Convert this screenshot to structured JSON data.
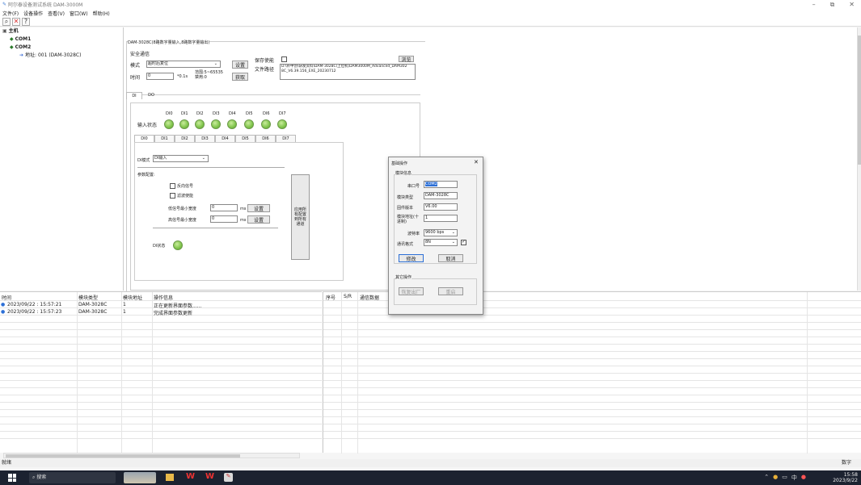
{
  "window": {
    "title": "阿尔泰设备测试系统 DAM-3000M",
    "minimize": "–",
    "maximize": "⧉",
    "close": "✕"
  },
  "menu": [
    "文件(F)",
    "设备操作",
    "查看(V)",
    "窗口(W)",
    "帮助(H)"
  ],
  "toolbar": {
    "search_icon": "⌕",
    "delete_icon": "✕",
    "help_icon": "?"
  },
  "tree": {
    "root": "主机",
    "com1": "COM1",
    "com2": "COM2",
    "device": "地址: 001 (DAM-3028C)"
  },
  "module": {
    "group_title": "DAM-3028C(8路数字量输入,8路数字量输出)",
    "safety_title": "安全通信",
    "mode_label": "模式",
    "mode_value": "超时后复位",
    "set_btn": "设置",
    "time_label": "时间",
    "time_value": "0",
    "time_unit": "*0.1s",
    "range_label": "范围:5~65535",
    "disable_label": "禁用:0",
    "get_btn": "获取",
    "save_enable_label": "保存使能",
    "save_path_label": "文件路径",
    "browse_btn": "浏览",
    "save_path_value": "D:\\补中创\\研发资料\\DAM-3028C\\上位机\\DAM3000M_Advanced_DAM3028C_V6.39.156_EXE_20230712"
  },
  "tabs_top": [
    "DI",
    "DO"
  ],
  "di_channels": [
    "DI0",
    "DI1",
    "DI2",
    "DI3",
    "DI4",
    "DI5",
    "DI6",
    "DI7"
  ],
  "input_status_label": "输入状态",
  "di_config": {
    "mode_label": "DI模式",
    "mode_value": "DI输入",
    "param_label": "参数配置:",
    "reverse": "反向信号",
    "filter": "滤波使能",
    "low_label": "低信号最小宽度",
    "low_value": "0",
    "low_unit": "ms",
    "high_label": "高信号最小宽度",
    "high_value": "0",
    "high_unit": "ms",
    "set1": "设置",
    "set2": "设置",
    "apply_all": "应用所有配置到所有通道",
    "state_label": "DI状态"
  },
  "dialog": {
    "title": "基础操作",
    "close": "✕",
    "module_info": "模块信息",
    "port_label": "串口号",
    "port_value": "COM2",
    "type_label": "模块类型",
    "type_value": "DAM-3028C",
    "firmware_label": "固件版本",
    "firmware_value": "V6.00",
    "addr_label": "模块地址(十进制)",
    "addr_value": "1",
    "baud_label": "波特率",
    "baud_value": "9600 bps",
    "fmt_label": "通讯格式",
    "fmt_value": "8N",
    "modify": "修改",
    "cancel": "取消",
    "other": "其它操作",
    "factory": "恢复出厂",
    "reboot": "重启"
  },
  "log": {
    "headers": [
      "时间",
      "模块类型",
      "模块地址",
      "操作信息"
    ],
    "rows": [
      [
        "2023/09/22 : 15:57:21",
        "DAM-3028C",
        "1",
        "正在更新界面参数......"
      ],
      [
        "2023/09/22 : 15:57:23",
        "DAM-3028C",
        "1",
        "完成界面参数更新"
      ]
    ]
  },
  "comm": {
    "headers": [
      "序号",
      "S/R",
      "通信数据"
    ]
  },
  "status": {
    "left": "就绪",
    "right": "数字"
  },
  "taskbar": {
    "search": "搜索",
    "time": "15:58",
    "date": "2023/9/22",
    "ime": "中"
  }
}
